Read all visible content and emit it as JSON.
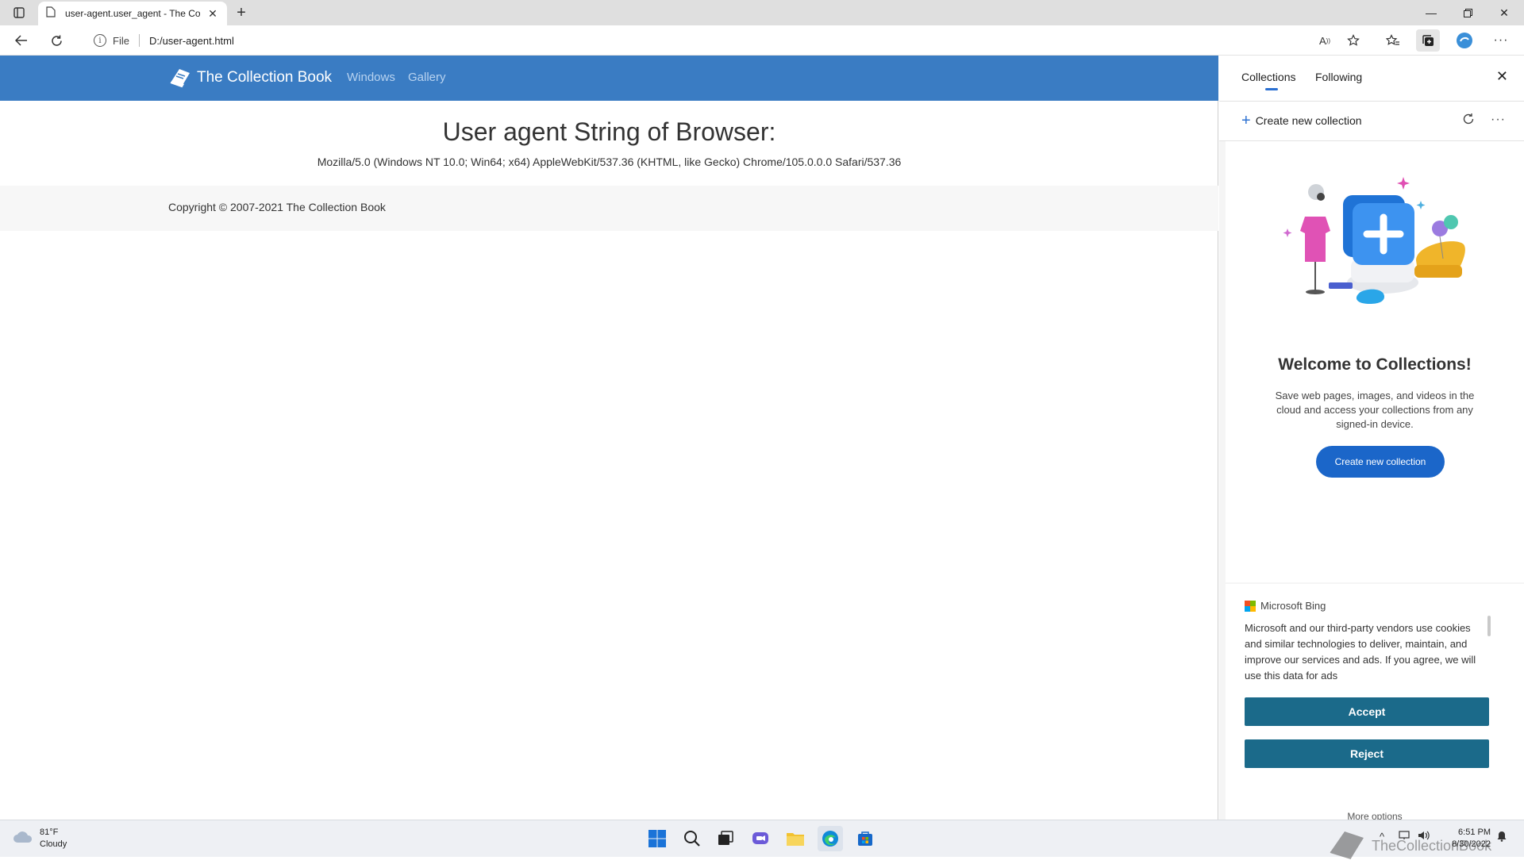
{
  "browser": {
    "tab_title": "user-agent.user_agent - The Collection Book",
    "address_scheme": "File",
    "address_url": "D:/user-agent.html"
  },
  "page": {
    "brand": "The Collection Book",
    "nav_links": [
      "Windows",
      "Gallery"
    ],
    "headline": "User agent String of Browser:",
    "user_agent": "Mozilla/5.0 (Windows NT 10.0; Win64; x64) AppleWebKit/537.36 (KHTML, like Gecko) Chrome/105.0.0.0 Safari/537.36",
    "copyright": "Copyright © 2007-2021 The Collection Book"
  },
  "panel": {
    "tabs": [
      "Collections",
      "Following"
    ],
    "create_link": "Create new collection",
    "welcome_title": "Welcome to Collections!",
    "welcome_desc": "Save web pages, images, and videos in the cloud and access your collections from any signed-in device.",
    "create_button": "Create new collection",
    "bing_label": "Microsoft Bing",
    "bing_text": "Microsoft and our third-party vendors use cookies and similar technologies to deliver, maintain, and improve our services and ads. If you agree, we will use this data for ads",
    "accept": "Accept",
    "reject": "Reject",
    "more_options": "More options"
  },
  "taskbar": {
    "temperature": "81°F",
    "condition": "Cloudy",
    "time": "6:51 PM",
    "date": "8/30/2022",
    "watermark": "TheCollectionBook"
  },
  "colors": {
    "navbar": "#3a7cc3",
    "accent": "#1b66c9",
    "bing_button": "#1b6a8a"
  }
}
